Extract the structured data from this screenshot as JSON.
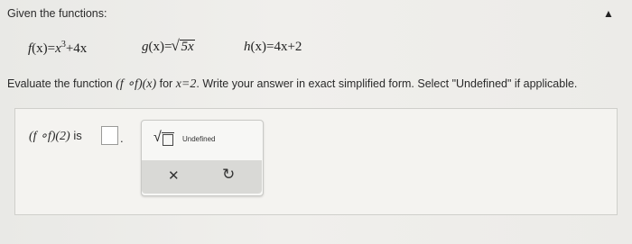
{
  "intro": "Given the functions:",
  "functions": {
    "f": {
      "lhs": "f",
      "var": "(x)",
      "eq": "=",
      "rhs": "x",
      "exp": "3",
      "tail": "+4x"
    },
    "g": {
      "lhs": "g",
      "var": "(x)",
      "eq": "=",
      "radicand": "5x"
    },
    "h": {
      "lhs": "h",
      "var": "(x)",
      "eq": "=",
      "rhs": "4x+2"
    }
  },
  "instruction": {
    "prefix": "Evaluate the function",
    "composite": "(f ∘f)(x)",
    "for": "for",
    "value": "x=2",
    "suffix": ". Write your answer in exact simplified form. Select \"Undefined\" if applicable."
  },
  "answer": {
    "expression": "(f ∘f)(2)",
    "is_label": "is",
    "period": ".",
    "value": ""
  },
  "palette": {
    "undefined_label": "Undefined",
    "sqrt_icon": "square-root-icon",
    "clear_icon": "x-icon",
    "undo_icon": "redo-icon"
  }
}
